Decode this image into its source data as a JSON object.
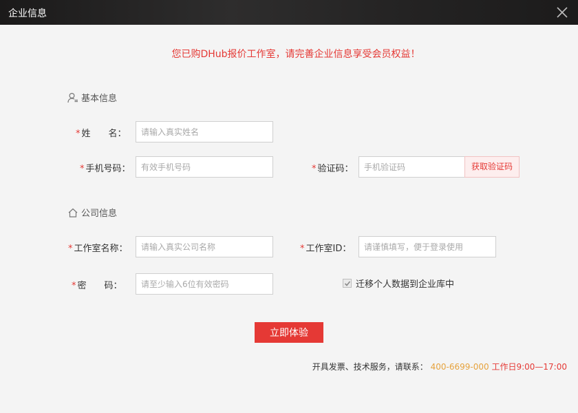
{
  "window": {
    "title": "企业信息"
  },
  "notice": "您已购DHub报价工作室，请完善企业信息享受会员权益！",
  "sections": {
    "basic": {
      "title": "基本信息",
      "icon": "user-icon"
    },
    "company": {
      "title": "公司信息",
      "icon": "home-icon"
    }
  },
  "fields": {
    "name": {
      "required_mark": "*",
      "label": "姓　　名：",
      "placeholder": "请输入真实姓名",
      "value": ""
    },
    "phone": {
      "required_mark": "*",
      "label": "手机号码：",
      "placeholder": "有效手机号码",
      "value": ""
    },
    "code": {
      "required_mark": "*",
      "label": "验证码：",
      "placeholder": "手机验证码",
      "value": "",
      "button": "获取验证码"
    },
    "studio_name": {
      "required_mark": "*",
      "label": "工作室名称：",
      "placeholder": "请输入真实公司名称",
      "value": ""
    },
    "studio_id": {
      "required_mark": "*",
      "label": "工作室ID：",
      "placeholder": "请谨慎填写，便于登录使用",
      "value": ""
    },
    "password": {
      "required_mark": "*",
      "label": "密　　码：",
      "placeholder": "请至少输入6位有效密码",
      "value": ""
    }
  },
  "migrate": {
    "label": "迁移个人数据到企业库中",
    "checked": true
  },
  "submit_label": "立即体验",
  "contact": {
    "prefix": "开具发票、技术服务，请联系：",
    "phone": "400-6699-000",
    "hours": "工作日9:00—17:00"
  },
  "colors": {
    "accent": "#e53935",
    "phone": "#e6a23c"
  }
}
